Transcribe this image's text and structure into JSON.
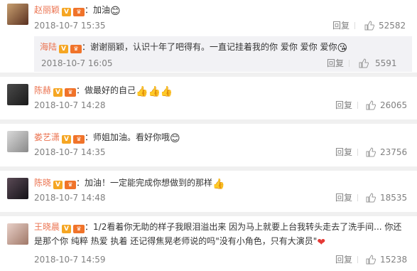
{
  "comments": [
    {
      "user": "赵丽颖",
      "text": "：加油",
      "emoji": "😊",
      "time": "2018-10-7 15:35",
      "reply_label": "回复",
      "likes": "52582",
      "reply": {
        "user": "海陆",
        "text": "：谢谢丽颖，认识十年了吧得有。一直记挂着我的你 爱你 爱你 爱你",
        "emoji": "😘",
        "time": "2018-10-7 16:05",
        "reply_label": "回复",
        "likes": "5591"
      }
    },
    {
      "user": "陈赫",
      "text": "：做最好的自己",
      "emoji": "👍👍👍",
      "time": "2018-10-7 14:28",
      "reply_label": "回复",
      "likes": "26065"
    },
    {
      "user": "娄艺潇",
      "text": "：师姐加油。看好你哦",
      "emoji": "😊",
      "time": "2018-10-7 14:35",
      "reply_label": "回复",
      "likes": "23756"
    },
    {
      "user": "陈晓",
      "text": "：加油！一定能完成你想做到的那样",
      "emoji": "👍",
      "time": "2018-10-7 14:48",
      "reply_label": "回复",
      "likes": "18535"
    },
    {
      "user": "王晓晨",
      "text": "：1/2看着你无助的样子我眼泪溢出来 因为马上就要上台我转头走去了洗手间... 你还",
      "text2": "是那个你 纯粹 热爱 执着 还记得焦晃老师说的吗\"没有小角色，只有大演员\"",
      "emoji": "❤",
      "time": "2018-10-7 14:59",
      "reply_label": "回复",
      "likes": "15238"
    }
  ],
  "badges": {
    "verified": "V",
    "level": "♛"
  },
  "colors": {
    "username": "#eb7350",
    "meta": "#808080",
    "separator": "#f0f0f0",
    "reply_bg": "#f2f2f5"
  }
}
